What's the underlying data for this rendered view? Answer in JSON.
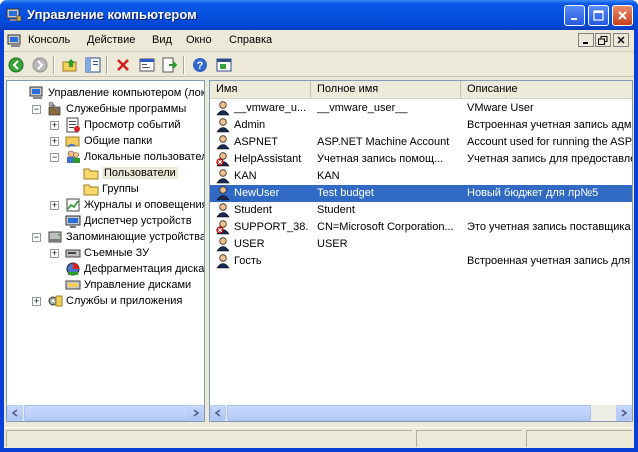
{
  "window": {
    "title": "Управление компьютером"
  },
  "menu": {
    "items": [
      "Консоль",
      "Действие",
      "Вид",
      "Окно",
      "Справка"
    ]
  },
  "tree": [
    {
      "label": "Управление компьютером (локаль",
      "level": 0,
      "exp": "",
      "icon": "computer"
    },
    {
      "label": "Служебные программы",
      "level": 1,
      "exp": "-",
      "icon": "tools"
    },
    {
      "label": "Просмотр событий",
      "level": 2,
      "exp": "+",
      "icon": "events"
    },
    {
      "label": "Общие папки",
      "level": 2,
      "exp": "+",
      "icon": "shares"
    },
    {
      "label": "Локальные пользователи",
      "level": 2,
      "exp": "-",
      "icon": "users"
    },
    {
      "label": "Пользователи",
      "level": 3,
      "exp": "",
      "icon": "folder",
      "selected": true
    },
    {
      "label": "Группы",
      "level": 3,
      "exp": "",
      "icon": "folder"
    },
    {
      "label": "Журналы и оповещения пр",
      "level": 2,
      "exp": "+",
      "icon": "logs"
    },
    {
      "label": "Диспетчер устройств",
      "level": 2,
      "exp": "",
      "icon": "devices"
    },
    {
      "label": "Запоминающие устройства",
      "level": 1,
      "exp": "-",
      "icon": "storage"
    },
    {
      "label": "Съемные ЗУ",
      "level": 2,
      "exp": "+",
      "icon": "removable"
    },
    {
      "label": "Дефрагментация диска",
      "level": 2,
      "exp": "",
      "icon": "defrag"
    },
    {
      "label": "Управление дисками",
      "level": 2,
      "exp": "",
      "icon": "disk"
    },
    {
      "label": "Службы и приложения",
      "level": 1,
      "exp": "+",
      "icon": "services"
    }
  ],
  "list": {
    "columns": [
      "Имя",
      "Полное имя",
      "Описание"
    ],
    "rows": [
      {
        "name": "__vmware_u...",
        "full": "__vmware_user__",
        "desc": "VMware User",
        "disabled": false,
        "selected": false
      },
      {
        "name": "Admin",
        "full": "",
        "desc": "Встроенная учетная запись адм",
        "disabled": false,
        "selected": false
      },
      {
        "name": "ASPNET",
        "full": "ASP.NET Machine Account",
        "desc": "Account used for running the ASP.I",
        "disabled": false,
        "selected": false
      },
      {
        "name": "HelpAssistant",
        "full": "Учетная запись помощ...",
        "desc": "Учетная запись для предоставле",
        "disabled": true,
        "selected": false
      },
      {
        "name": "KAN",
        "full": "KAN",
        "desc": "",
        "disabled": false,
        "selected": false
      },
      {
        "name": "NewUser",
        "full": "Test budget",
        "desc": "Новый бюджет для лр№5",
        "disabled": false,
        "selected": true
      },
      {
        "name": "Student",
        "full": "Student",
        "desc": "",
        "disabled": false,
        "selected": false
      },
      {
        "name": "SUPPORT_38...",
        "full": "CN=Microsoft Corporation...",
        "desc": "Это учетная запись поставщика",
        "disabled": true,
        "selected": false
      },
      {
        "name": "USER",
        "full": "USER",
        "desc": "",
        "disabled": false,
        "selected": false
      },
      {
        "name": "Гость",
        "full": "",
        "desc": "Встроенная учетная запись для ...",
        "disabled": false,
        "selected": false
      }
    ]
  }
}
